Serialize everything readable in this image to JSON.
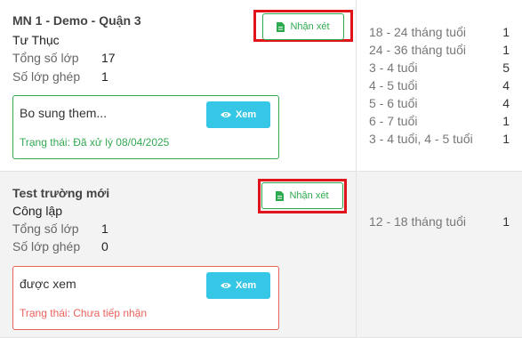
{
  "schools": [
    {
      "name": "MN 1 - Demo - Quận 3",
      "type": "Tư Thục",
      "total_classes_label": "Tổng số lớp",
      "total_classes": "17",
      "merged_classes_label": "Số lớp ghép",
      "merged_classes": "1",
      "comment_button": "Nhận xét",
      "feedback_text": "Bo sung them...",
      "view_button": "Xem",
      "status_text": "Trạng thái: Đã xử lý 08/04/2025",
      "status_color": "#34a853",
      "age_groups": [
        {
          "label": "18 - 24 tháng tuổi",
          "count": "1"
        },
        {
          "label": "24 - 36 tháng tuổi",
          "count": "1"
        },
        {
          "label": "3 - 4 tuổi",
          "count": "5"
        },
        {
          "label": "4 - 5 tuổi",
          "count": "4"
        },
        {
          "label": "5 - 6 tuổi",
          "count": "4"
        },
        {
          "label": "6 - 7 tuổi",
          "count": "1"
        },
        {
          "label": "3 - 4 tuổi, 4 - 5 tuổi",
          "count": "1"
        }
      ]
    },
    {
      "name": "Test trường mới",
      "type": "Công lập",
      "total_classes_label": "Tổng số lớp",
      "total_classes": "1",
      "merged_classes_label": "Số lớp ghép",
      "merged_classes": "0",
      "comment_button": "Nhận xét",
      "feedback_text": "được xem",
      "view_button": "Xem",
      "status_text": "Trạng thái: Chưa tiếp nhận",
      "status_color": "#e8625d",
      "age_groups": [
        {
          "label": "12 - 18 tháng tuổi",
          "count": "1"
        }
      ]
    }
  ],
  "colors": {
    "accent_green": "#2eaa4e",
    "view_button_bg": "#36c6e6",
    "highlight_red": "#e0141b"
  },
  "icons": {
    "comment_button_icon": "document-icon",
    "view_button_icon": "eye-icon"
  }
}
